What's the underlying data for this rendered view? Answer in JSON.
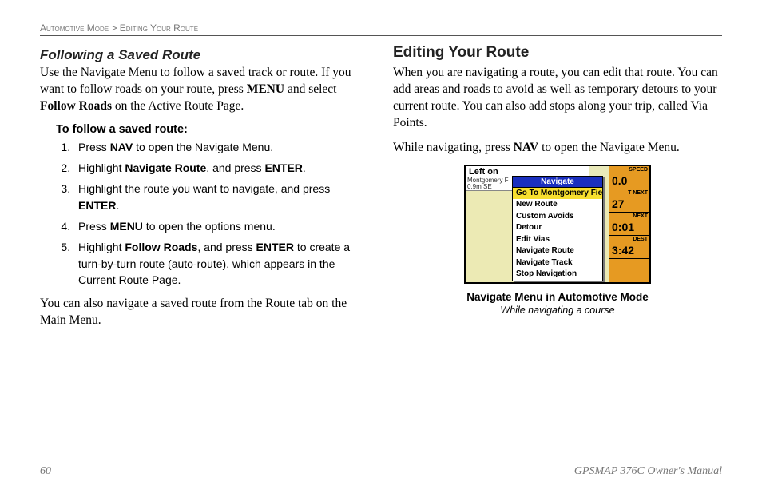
{
  "breadcrumb": {
    "section": "Automotive Mode",
    "sep": ">",
    "page": "Editing Your Route"
  },
  "left": {
    "heading": "Following a Saved Route",
    "intro_pre": "Use the Navigate Menu to follow a saved track or route. If you want to follow roads on your route, press ",
    "intro_k1": "MENU",
    "intro_mid": " and select ",
    "intro_k2": "Follow Roads",
    "intro_post": " on the Active Route Page.",
    "subhead": "To follow a saved route:",
    "steps": [
      {
        "pre": "Press ",
        "b1": "NAV",
        "post": " to open the Navigate Menu."
      },
      {
        "pre": "Highlight ",
        "b1": "Navigate Route",
        "mid": ", and press ",
        "b2": "ENTER",
        "post": "."
      },
      {
        "pre": "Highlight the route you want to navigate, and press ",
        "b1": "ENTER",
        "post": "."
      },
      {
        "pre": "Press ",
        "b1": "MENU",
        "post": " to open the options menu."
      },
      {
        "pre": "Highlight ",
        "b1": "Follow Roads",
        "mid": ", and press ",
        "b2": "ENTER",
        "post": " to create a turn-by-turn route (auto-route), which appears in the Current Route Page."
      }
    ],
    "outro": "You can also navigate a saved route from the Route tab on the Main Menu."
  },
  "right": {
    "heading": "Editing Your Route",
    "p1": "When you are navigating a route, you can edit that route. You can add areas and roads to avoid as well as temporary detours to your current route. You can also add stops along your trip, called Via Points.",
    "p2_pre": "While navigating, press ",
    "p2_b": "NAV",
    "p2_post": " to open the Navigate Menu.",
    "screenshot": {
      "topbar": "Left on",
      "strip_l1": "Montgomery F",
      "strip_l2": "0.9m   SE",
      "menu_title": "Navigate",
      "menu_items": [
        "Go To Montgomery Fie",
        "New Route",
        "Custom Avoids",
        "Detour",
        "Edit Vias",
        "Navigate Route",
        "Navigate Track",
        "Stop Navigation"
      ],
      "side_labels": [
        "SPEED",
        "T NEXT",
        "NEXT",
        "DEST"
      ],
      "side_values": [
        "0.0",
        "27",
        "0:01",
        "3:42"
      ]
    },
    "caption1": "Navigate Menu in Automotive Mode",
    "caption2": "While navigating a course"
  },
  "footer": {
    "page": "60",
    "manual": "GPSMAP 376C Owner's Manual"
  }
}
